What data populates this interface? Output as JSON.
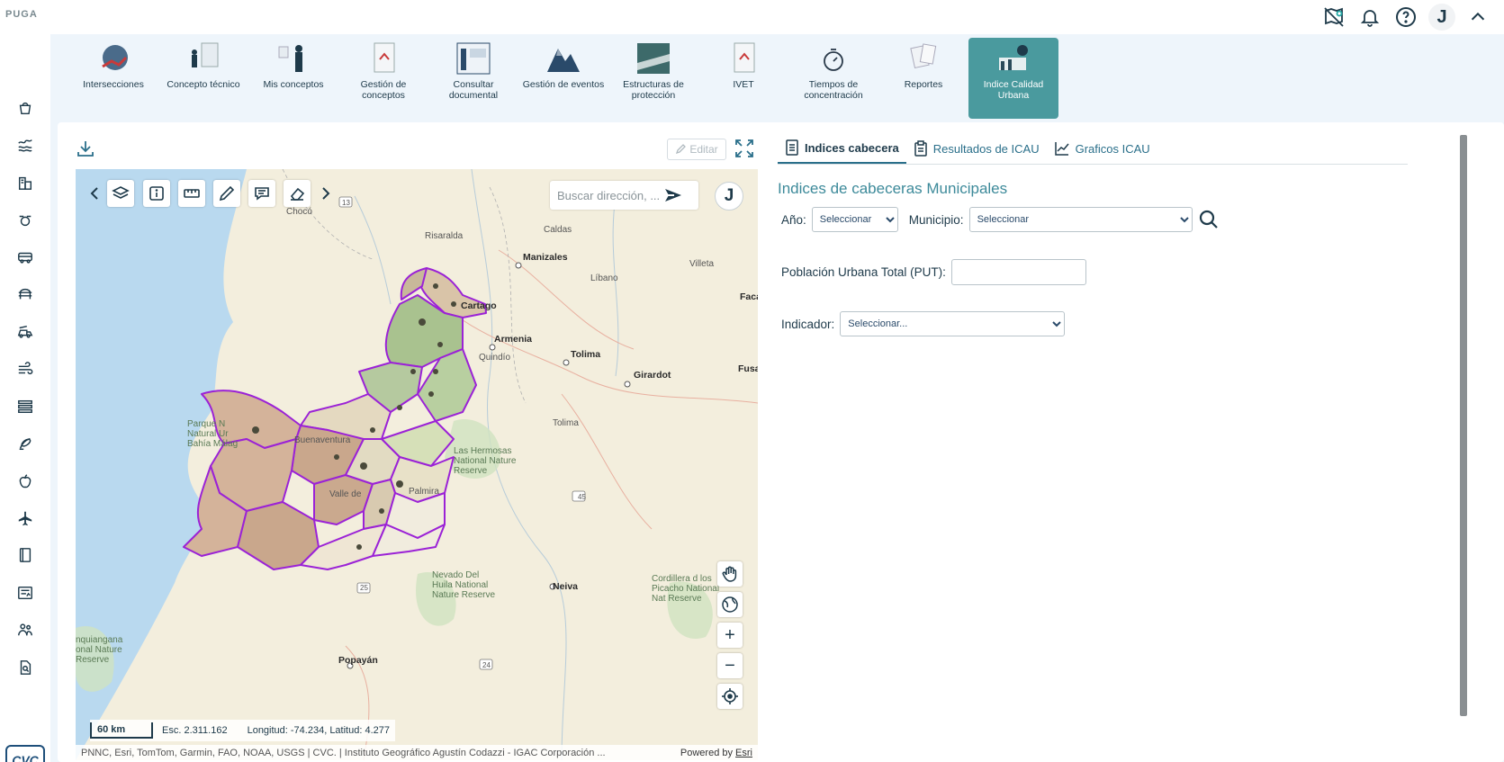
{
  "app": {
    "logo_text": "PUGA"
  },
  "topbar": {
    "icons": [
      "map-pin-off-icon",
      "bell-icon",
      "help-icon"
    ],
    "user_initial": "J"
  },
  "sidebar": {
    "items": [
      "bucket-icon",
      "waves-icon",
      "buildings-icon",
      "pump-icon",
      "bus-icon",
      "bridge-icon",
      "fire-truck-icon",
      "wind-icon",
      "stacked-layers-icon",
      "satellite-icon",
      "apple-icon",
      "airplane-icon",
      "book-icon",
      "report-icon",
      "people-icon",
      "search-doc-icon"
    ],
    "footer_logo": "CVC"
  },
  "modules": [
    {
      "label": "Intersecciones",
      "active": false
    },
    {
      "label": "Concepto técnico",
      "active": false
    },
    {
      "label": "Mis conceptos",
      "active": false
    },
    {
      "label": "Gestión de conceptos",
      "active": false
    },
    {
      "label": "Consultar documental",
      "active": false
    },
    {
      "label": "Gestión de eventos",
      "active": false
    },
    {
      "label": "Estructuras de protección",
      "active": false
    },
    {
      "label": "IVET",
      "active": false
    },
    {
      "label": "Tiempos de concentración",
      "active": false
    },
    {
      "label": "Reportes",
      "active": false
    },
    {
      "label": "Indice Calidad Urbana",
      "active": true
    }
  ],
  "map_panel": {
    "edit_label": "Editar",
    "search_placeholder": "Buscar dirección, ...",
    "user_initial": "J",
    "scale_bar": "60 km",
    "scale": "Esc. 2.311.162",
    "coords": "Longitud: -74.234, Latitud: 4.277",
    "attribution": "PNNC, Esri, TomTom, Garmin, FAO, NOAA, USGS | CVC. | Instituto Geográfico Agustín Codazzi - IGAC Corporación ...",
    "powered_by": "Powered by",
    "powered_link": "Esri",
    "labels": {
      "choco": "Chocó",
      "risaralda": "Risaralda",
      "caldas": "Caldas",
      "manizales": "Manizales",
      "libano": "Líbano",
      "villeta": "Villeta",
      "cartago": "Cartago",
      "faca": "Faca",
      "armenia": "Armenia",
      "quindio": "Quindío",
      "tolima_city": "Tolima",
      "girardot": "Girardot",
      "fusa": "Fusa",
      "tolima_dept": "Tolima",
      "parque": "Parque N Natural Ur Bahía Málag",
      "buenaventura": "Buenaventura",
      "las_hermosas": "Las Hermosas National Nature Reserve",
      "palmira": "Palmira",
      "valle": "Valle de",
      "nevado": "Nevado Del Huila National Nature Reserve",
      "neiva": "Neiva",
      "cordillera": "Cordillera d los Picacho National Nat Reserve",
      "munchique": "nquiangana onal Nature Reserve",
      "popayan": "Popayán",
      "road13": "13",
      "road45": "45",
      "road25": "25",
      "road24": "24"
    }
  },
  "right_panel": {
    "tabs": [
      {
        "label": "Indices cabecera",
        "icon": "list-doc-icon",
        "active": true
      },
      {
        "label": "Resultados de ICAU",
        "icon": "clipboard-icon",
        "active": false
      },
      {
        "label": "Graficos ICAU",
        "icon": "line-chart-icon",
        "active": false
      }
    ],
    "title": "Indices de cabeceras Municipales",
    "year_label": "Año:",
    "year_selected": "Seleccionar",
    "municipio_label": "Municipio:",
    "municipio_selected": "Seleccionar",
    "put_label": "Población Urbana Total (PUT):",
    "put_value": "",
    "indicador_label": "Indicador:",
    "indicador_selected": "Seleccionar..."
  }
}
